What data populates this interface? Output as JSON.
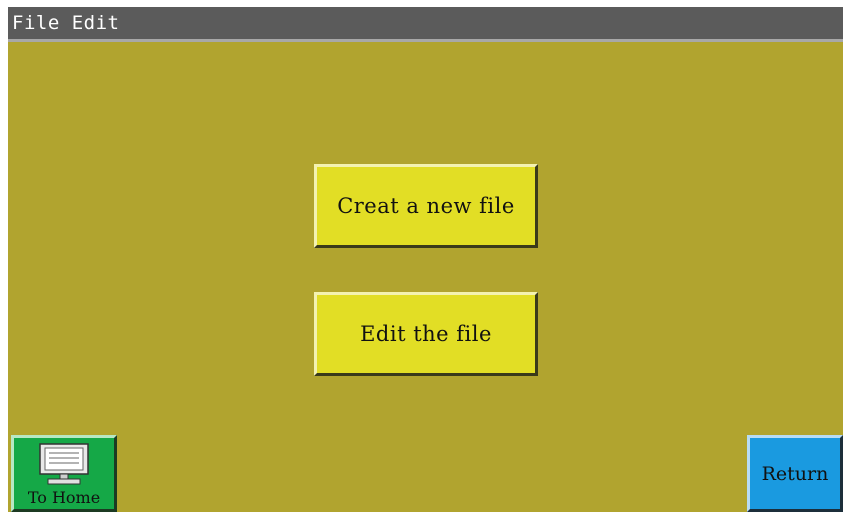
{
  "window": {
    "title": "File Edit"
  },
  "main": {
    "create_label": "Creat a new file",
    "edit_label": "Edit the file"
  },
  "footer": {
    "home_label": "To Home",
    "home_icon": "monitor-icon",
    "return_label": "Return"
  },
  "colors": {
    "background": "#b1a42f",
    "titlebar": "#5b5b5b",
    "primary_button": "#e2de25",
    "home_button": "#15a847",
    "return_button": "#1a9ae0"
  }
}
